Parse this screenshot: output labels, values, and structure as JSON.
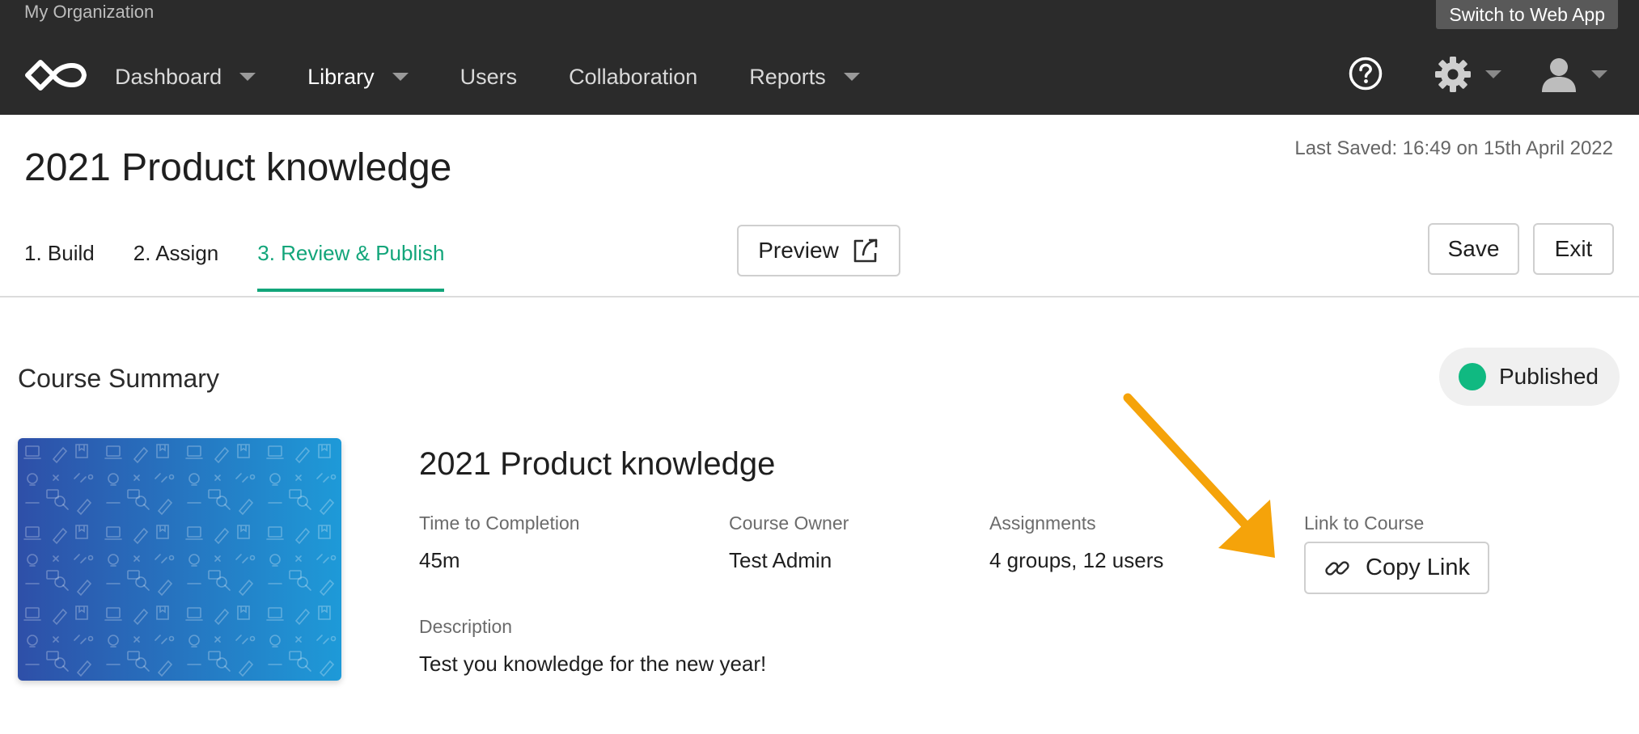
{
  "topbar": {
    "org_name": "My Organization",
    "switch_label": "Switch to Web App",
    "nav": [
      {
        "label": "Dashboard",
        "has_dropdown": true
      },
      {
        "label": "Library",
        "has_dropdown": true
      },
      {
        "label": "Users",
        "has_dropdown": false
      },
      {
        "label": "Collaboration",
        "has_dropdown": false
      },
      {
        "label": "Reports",
        "has_dropdown": true
      }
    ],
    "active_nav": "Library",
    "icons": [
      "logo-icon",
      "help-icon",
      "gear-icon",
      "user-icon"
    ]
  },
  "header": {
    "title": "2021 Product knowledge",
    "last_saved": "Last Saved: 16:49 on 15th April 2022",
    "tabs": [
      {
        "label": "1. Build"
      },
      {
        "label": "2. Assign"
      },
      {
        "label": "3. Review & Publish"
      }
    ],
    "active_tab": "3. Review & Publish",
    "preview_label": "Preview",
    "save_label": "Save",
    "exit_label": "Exit"
  },
  "summary": {
    "section_title": "Course Summary",
    "status": "Published",
    "course_name": "2021 Product knowledge",
    "fields": {
      "time_label": "Time to Completion",
      "time_value": "45m",
      "owner_label": "Course Owner",
      "owner_value": "Test Admin",
      "assignments_label": "Assignments",
      "assignments_value": "4 groups, 12 users",
      "link_label": "Link to Course",
      "copy_label": "Copy Link",
      "description_label": "Description",
      "description_value": "Test you knowledge for the new year!"
    }
  },
  "colors": {
    "topbar_bg": "#2b2b2b",
    "accent_green": "#12a57a",
    "status_green": "#10b981",
    "arrow_orange": "#f5a30a",
    "thumb_gradient_start": "#2e4fa8",
    "thumb_gradient_end": "#1e9ad8"
  }
}
